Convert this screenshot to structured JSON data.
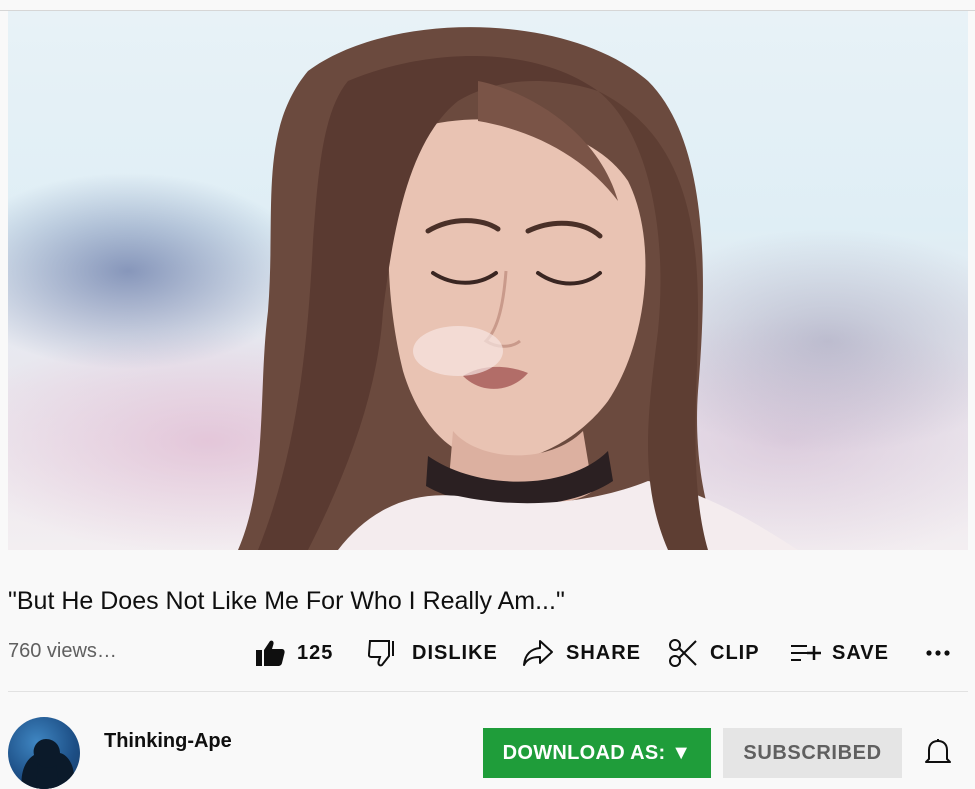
{
  "video": {
    "title": "\"But He Does Not Like Me For Who I Really Am...\"",
    "views": "760 views…"
  },
  "actions": {
    "like_count": "125",
    "dislike_label": "DISLIKE",
    "share_label": "SHARE",
    "clip_label": "CLIP",
    "save_label": "SAVE"
  },
  "channel": {
    "name": "Thinking-Ape"
  },
  "buttons": {
    "download_label": "DOWNLOAD AS: ▼",
    "subscribed_label": "SUBSCRIBED",
    "download_color": "#1f9d3a"
  },
  "icons": {
    "like": "thumbs-up-icon",
    "dislike": "thumbs-down-icon",
    "share": "share-arrow-icon",
    "clip": "scissors-icon",
    "save": "playlist-add-icon",
    "more": "more-horizontal-icon",
    "notifications": "bell-icon"
  }
}
